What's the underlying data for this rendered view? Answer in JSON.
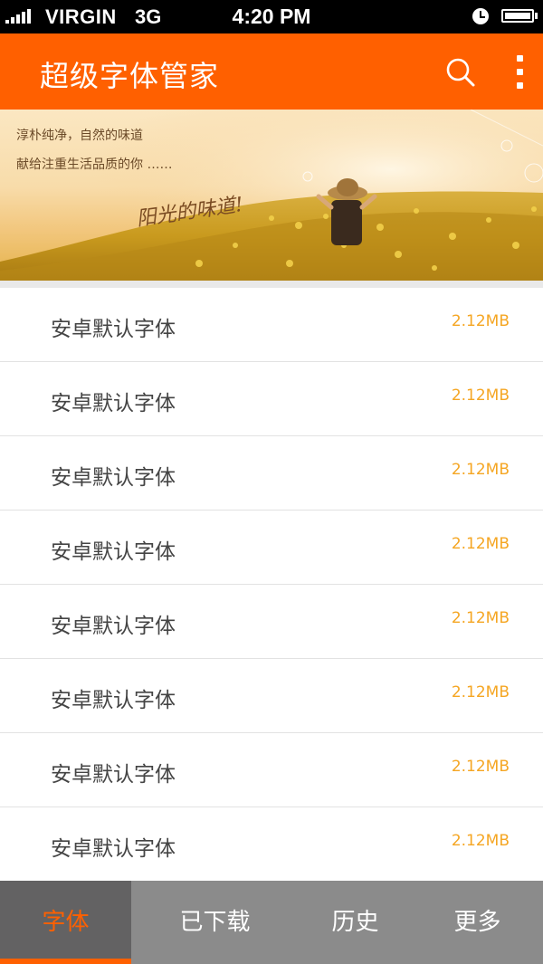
{
  "status_bar": {
    "carrier": "VIRGIN",
    "network": "3G",
    "time": "4:20 PM"
  },
  "app_bar": {
    "title": "超级字体管家",
    "search_icon": "search-icon",
    "more_icon": "more-vertical-icon"
  },
  "banner": {
    "line1": "淳朴纯净，自然的味道",
    "line2": "献给注重生活品质的你 ……",
    "script_text": "阳光的味道!"
  },
  "font_list": [
    {
      "name": "安卓默认字体",
      "size": "2.12MB"
    },
    {
      "name": "安卓默认字体",
      "size": "2.12MB"
    },
    {
      "name": "安卓默认字体",
      "size": "2.12MB"
    },
    {
      "name": "安卓默认字体",
      "size": "2.12MB"
    },
    {
      "name": "安卓默认字体",
      "size": "2.12MB"
    },
    {
      "name": "安卓默认字体",
      "size": "2.12MB"
    },
    {
      "name": "安卓默认字体",
      "size": "2.12MB"
    },
    {
      "name": "安卓默认字体",
      "size": "2.12MB"
    }
  ],
  "tabs": [
    {
      "label": "字体",
      "active": true
    },
    {
      "label": "已下载",
      "active": false
    },
    {
      "label": "历史",
      "active": false
    },
    {
      "label": "更多",
      "active": false
    }
  ],
  "colors": {
    "accent": "#ff6000",
    "size_text": "#f5a623",
    "tabbar_bg": "#8b8b8b",
    "tab_active_bg": "#636263"
  }
}
